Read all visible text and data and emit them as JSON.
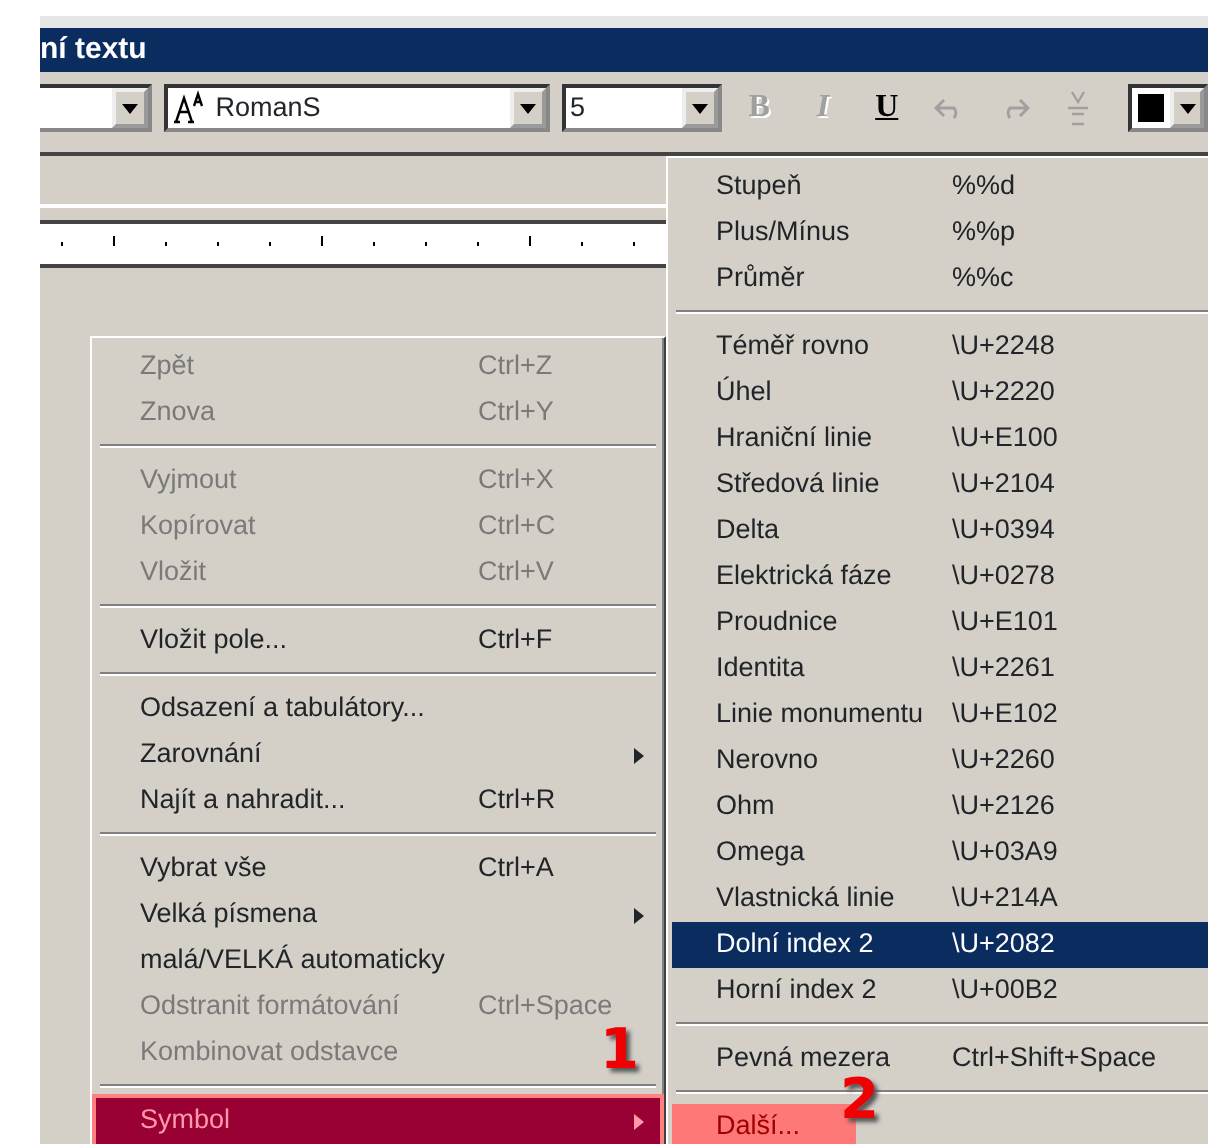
{
  "window": {
    "title": "ní textu"
  },
  "toolbar": {
    "font_combo": {
      "value": "RomanS"
    },
    "size_combo": {
      "value": "5"
    },
    "buttons": [
      {
        "kind": "bold",
        "label": "B",
        "disabled": true
      },
      {
        "kind": "italic",
        "label": "I",
        "disabled": true
      },
      {
        "kind": "underline",
        "label": "U",
        "disabled": false
      },
      {
        "kind": "undo",
        "disabled": true
      },
      {
        "kind": "redo",
        "disabled": true
      },
      {
        "kind": "stack",
        "disabled": true
      }
    ],
    "color": {
      "color": "#000000"
    }
  },
  "context_menu": {
    "items": [
      {
        "kind": "item",
        "label": "Zpět",
        "shortcut": "Ctrl+Z",
        "disabled": true,
        "submenu": false,
        "selected": false,
        "marked": false
      },
      {
        "kind": "item",
        "label": "Znova",
        "shortcut": "Ctrl+Y",
        "disabled": true,
        "submenu": false,
        "selected": false,
        "marked": false
      },
      {
        "kind": "separator"
      },
      {
        "kind": "item",
        "label": "Vyjmout",
        "shortcut": "Ctrl+X",
        "disabled": true,
        "submenu": false,
        "selected": false,
        "marked": false
      },
      {
        "kind": "item",
        "label": "Kopírovat",
        "shortcut": "Ctrl+C",
        "disabled": true,
        "submenu": false,
        "selected": false,
        "marked": false
      },
      {
        "kind": "item",
        "label": "Vložit",
        "shortcut": "Ctrl+V",
        "disabled": true,
        "submenu": false,
        "selected": false,
        "marked": false
      },
      {
        "kind": "separator"
      },
      {
        "kind": "item",
        "label": "Vložit pole...",
        "shortcut": "Ctrl+F",
        "disabled": false,
        "submenu": false,
        "selected": false,
        "marked": false
      },
      {
        "kind": "separator"
      },
      {
        "kind": "item",
        "label": "Odsazení a tabulátory...",
        "disabled": false,
        "submenu": false,
        "selected": false,
        "marked": false
      },
      {
        "kind": "item",
        "label": "Zarovnání",
        "disabled": false,
        "submenu": true,
        "selected": false,
        "marked": false
      },
      {
        "kind": "item",
        "label": "Najít a nahradit...",
        "shortcut": "Ctrl+R",
        "disabled": false,
        "submenu": false,
        "selected": false,
        "marked": false
      },
      {
        "kind": "separator"
      },
      {
        "kind": "item",
        "label": "Vybrat vše",
        "shortcut": "Ctrl+A",
        "disabled": false,
        "submenu": false,
        "selected": false,
        "marked": false
      },
      {
        "kind": "item",
        "label": "Velká písmena",
        "disabled": false,
        "submenu": true,
        "selected": false,
        "marked": false
      },
      {
        "kind": "item",
        "label": "malá/VELKÁ automaticky",
        "disabled": false,
        "submenu": false,
        "selected": false,
        "marked": false
      },
      {
        "kind": "item",
        "label": "Odstranit formátování",
        "shortcut": "Ctrl+Space",
        "disabled": true,
        "submenu": false,
        "selected": false,
        "marked": false
      },
      {
        "kind": "item",
        "label": "Kombinovat odstavce",
        "disabled": true,
        "submenu": false,
        "selected": false,
        "marked": false
      },
      {
        "kind": "separator"
      },
      {
        "kind": "item",
        "label": "Symbol",
        "disabled": false,
        "submenu": true,
        "selected": true,
        "marked": true
      }
    ]
  },
  "submenu": {
    "items": [
      {
        "kind": "item",
        "label": "Stupeň",
        "code": "%%d",
        "selected": false,
        "marked": false
      },
      {
        "kind": "item",
        "label": "Plus/Mínus",
        "code": "%%p",
        "selected": false,
        "marked": false
      },
      {
        "kind": "item",
        "label": "Průměr",
        "code": "%%c",
        "selected": false,
        "marked": false
      },
      {
        "kind": "separator"
      },
      {
        "kind": "item",
        "label": "Téměř rovno",
        "code": "\\U+2248",
        "selected": false,
        "marked": false
      },
      {
        "kind": "item",
        "label": "Úhel",
        "code": "\\U+2220",
        "selected": false,
        "marked": false
      },
      {
        "kind": "item",
        "label": "Hraniční linie",
        "code": "\\U+E100",
        "selected": false,
        "marked": false
      },
      {
        "kind": "item",
        "label": "Středová linie",
        "code": "\\U+2104",
        "selected": false,
        "marked": false
      },
      {
        "kind": "item",
        "label": "Delta",
        "code": "\\U+0394",
        "selected": false,
        "marked": false
      },
      {
        "kind": "item",
        "label": "Elektrická fáze",
        "code": "\\U+0278",
        "selected": false,
        "marked": false
      },
      {
        "kind": "item",
        "label": "Proudnice",
        "code": "\\U+E101",
        "selected": false,
        "marked": false
      },
      {
        "kind": "item",
        "label": "Identita",
        "code": "\\U+2261",
        "selected": false,
        "marked": false
      },
      {
        "kind": "item",
        "label": "Linie monumentu",
        "code": "\\U+E102",
        "selected": false,
        "marked": false
      },
      {
        "kind": "item",
        "label": "Nerovno",
        "code": "\\U+2260",
        "selected": false,
        "marked": false
      },
      {
        "kind": "item",
        "label": "Ohm",
        "code": "\\U+2126",
        "selected": false,
        "marked": false
      },
      {
        "kind": "item",
        "label": "Omega",
        "code": "\\U+03A9",
        "selected": false,
        "marked": false
      },
      {
        "kind": "item",
        "label": "Vlastnická linie",
        "code": "\\U+214A",
        "selected": false,
        "marked": false
      },
      {
        "kind": "item",
        "label": "Dolní index 2",
        "code": "\\U+2082",
        "selected": true,
        "marked": false
      },
      {
        "kind": "item",
        "label": "Horní index 2",
        "code": "\\U+00B2",
        "selected": false,
        "marked": false
      },
      {
        "kind": "separator"
      },
      {
        "kind": "item",
        "label": "Pevná mezera",
        "code": "Ctrl+Shift+Space",
        "selected": false,
        "marked": false
      },
      {
        "kind": "separator"
      },
      {
        "kind": "item",
        "label": "Další...",
        "selected": false,
        "marked": true
      }
    ]
  },
  "annotations": [
    {
      "label": "1"
    },
    {
      "label": "2"
    }
  ]
}
